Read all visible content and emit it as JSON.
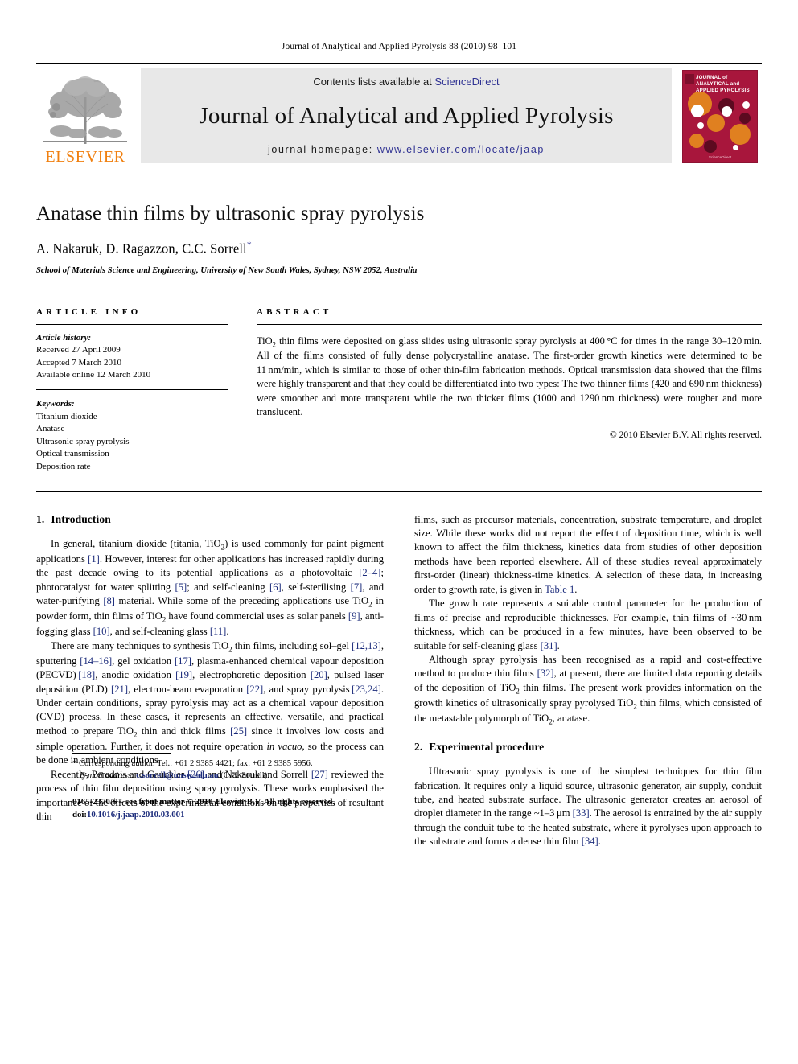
{
  "running_head": "Journal of Analytical and Applied Pyrolysis 88 (2010) 98–101",
  "banner": {
    "contents_prefix": "Contents lists available at ",
    "contents_link": "ScienceDirect",
    "journal_title": "Journal of Analytical and Applied Pyrolysis",
    "homepage_prefix": "journal homepage: ",
    "homepage_url": "www.elsevier.com/locate/jaap",
    "publisher_wordmark": "ELSEVIER",
    "cover": {
      "line1": "JOURNAL of",
      "line2": "ANALYTICAL and",
      "line3": "APPLIED PYROLYSIS",
      "footer": "ScienceDirect"
    },
    "colors": {
      "link_blue": "#2e3192",
      "elsevier_orange": "#F08010",
      "cover_red": "#A8163C",
      "banner_grey": "#e8e8e8"
    }
  },
  "article": {
    "title": "Anatase thin films by ultrasonic spray pyrolysis",
    "authors": "A. Nakaruk, D. Ragazzon, C.C. Sorrell",
    "corresponding_marker": "*",
    "affiliation": "School of Materials Science and Engineering, University of New South Wales, Sydney, NSW 2052, Australia"
  },
  "article_info": {
    "heading": "ARTICLE INFO",
    "history_label": "Article history:",
    "history": [
      "Received 27 April 2009",
      "Accepted 7 March 2010",
      "Available online 12 March 2010"
    ],
    "keywords_label": "Keywords:",
    "keywords": [
      "Titanium dioxide",
      "Anatase",
      "Ultrasonic spray pyrolysis",
      "Optical transmission",
      "Deposition rate"
    ]
  },
  "abstract": {
    "heading": "ABSTRACT",
    "text": "TiO2 thin films were deposited on glass slides using ultrasonic spray pyrolysis at 400 °C for times in the range 30–120 min. All of the films consisted of fully dense polycrystalline anatase. The first-order growth kinetics were determined to be 11 nm/min, which is similar to those of other thin-film fabrication methods. Optical transmission data showed that the films were highly transparent and that they could be differentiated into two types: The two thinner films (420 and 690 nm thickness) were smoother and more transparent while the two thicker films (1000 and 1290 nm thickness) were rougher and more translucent.",
    "copyright": "© 2010 Elsevier B.V. All rights reserved."
  },
  "sections": {
    "intro_number": "1.",
    "intro_title": "Introduction",
    "exp_number": "2.",
    "exp_title": "Experimental procedure"
  },
  "body": {
    "left": {
      "p1_a": "In general, titanium dioxide (titania, TiO",
      "p1_b": ") is used commonly for paint pigment applications ",
      "p1_r1": "[1]",
      "p1_c": ". However, interest for other applications has increased rapidly during the past decade owing to its potential applications as a photovoltaic ",
      "p1_r2": "[2–4]",
      "p1_d": "; photocatalyst for water splitting ",
      "p1_r3": "[5]",
      "p1_e": "; and self-cleaning ",
      "p1_r4": "[6]",
      "p1_f": ", self-sterilising ",
      "p1_r5": "[7]",
      "p1_g": ", and water-purifying ",
      "p1_r6": "[8]",
      "p1_h": " material. While some of the preceding applications use TiO",
      "p1_i": " in powder form, thin films of TiO",
      "p1_j": " have found commercial uses as solar panels ",
      "p1_r7": "[9]",
      "p1_k": ", anti-fogging glass ",
      "p1_r8": "[10]",
      "p1_l": ", and self-cleaning glass ",
      "p1_r9": "[11]",
      "p1_m": ".",
      "p2_a": "There are many techniques to synthesis TiO",
      "p2_b": " thin films, including sol–gel ",
      "p2_r1": "[12,13]",
      "p2_c": ", sputtering ",
      "p2_r2": "[14–16]",
      "p2_d": ", gel oxidation ",
      "p2_r3": "[17]",
      "p2_e": ", plasma-enhanced chemical vapour deposition (PECVD) ",
      "p2_r4": "[18]",
      "p2_f": ", anodic oxidation ",
      "p2_r5": "[19]",
      "p2_g": ", electrophoretic deposition ",
      "p2_r6": "[20]",
      "p2_h": ", pulsed laser deposition (PLD) ",
      "p2_r7": "[21]",
      "p2_i": ", electron-beam evaporation ",
      "p2_r8": "[22]",
      "p2_j": ", and spray pyrolysis ",
      "p2_r9": "[23,24]",
      "p2_k": ". Under certain conditions, spray pyrolysis may act as a chemical vapour deposition (CVD) process. In these cases, it represents an effective, versatile, and practical method to prepare TiO",
      "p2_l": " thin and thick films ",
      "p2_r10": "[25]",
      "p2_m": " since it involves low costs and simple operation. Further, it does not require operation ",
      "p2_ital": "in vacuo",
      "p2_n": ", so the process can be done in ambient conditions.",
      "p3_a": "Recently, Perednis and Gauckler ",
      "p3_r1": "[26]",
      "p3_b": " and Nakaruk and Sorrell ",
      "p3_r2": "[27]",
      "p3_c": " reviewed the process of thin film deposition using spray pyrolysis. These works emphasised the importance of the effects of the experimental conditions on the properties of resultant thin"
    },
    "right": {
      "p4_a": "films, such as precursor materials, concentration, substrate temperature, and droplet size. While these works did not report the effect of deposition time, which is well known to affect the film thickness, kinetics data from studies of other deposition methods have been reported elsewhere. All of these studies reveal approximately first-order (linear) thickness-time kinetics. A selection of these data, in increasing order to growth rate, is given in ",
      "p4_xref": "Table 1",
      "p4_b": ".",
      "p5_a": "The growth rate represents a suitable control parameter for the production of films of precise and reproducible thicknesses. For example, thin films of ~30 nm thickness, which can be produced in a few minutes, have been observed to be suitable for self-cleaning glass ",
      "p5_r1": "[31]",
      "p5_b": ".",
      "p6_a": "Although spray pyrolysis has been recognised as a rapid and cost-effective method to produce thin films ",
      "p6_r1": "[32]",
      "p6_b": ", at present, there are limited data reporting details of the deposition of TiO",
      "p6_c": " thin films. The present work provides information on the growth kinetics of ultrasonically spray pyrolysed TiO",
      "p6_d": " thin films, which consisted of the metastable polymorph of TiO",
      "p6_e": ", anatase.",
      "p7_a": "Ultrasonic spray pyrolysis is one of the simplest techniques for thin film fabrication. It requires only a liquid source, ultrasonic generator, air supply, conduit tube, and heated substrate surface. The ultrasonic generator creates an aerosol of droplet diameter in the range ~1–3 μm ",
      "p7_r1": "[33]",
      "p7_b": ". The aerosol is entrained by the air supply through the conduit tube to the heated substrate, where it pyrolyses upon approach to the substrate and forms a dense thin film ",
      "p7_r2": "[34]",
      "p7_c": "."
    }
  },
  "footnotes": {
    "corr_marker": "*",
    "corr_text": " Corresponding author. Tel.: +61 2 9385 4421; fax: +61 2 9385 5956.",
    "email_label": "E-mail address:",
    "email": "c.sorrell@unsw.edu.au",
    "email_suffix": " (C.C. Sorrell).",
    "issn_line": "0165-2370/$ – see front matter © 2010 Elsevier B.V. All rights reserved.",
    "doi_label": "doi:",
    "doi_value": "10.1016/j.jaap.2010.03.001"
  }
}
